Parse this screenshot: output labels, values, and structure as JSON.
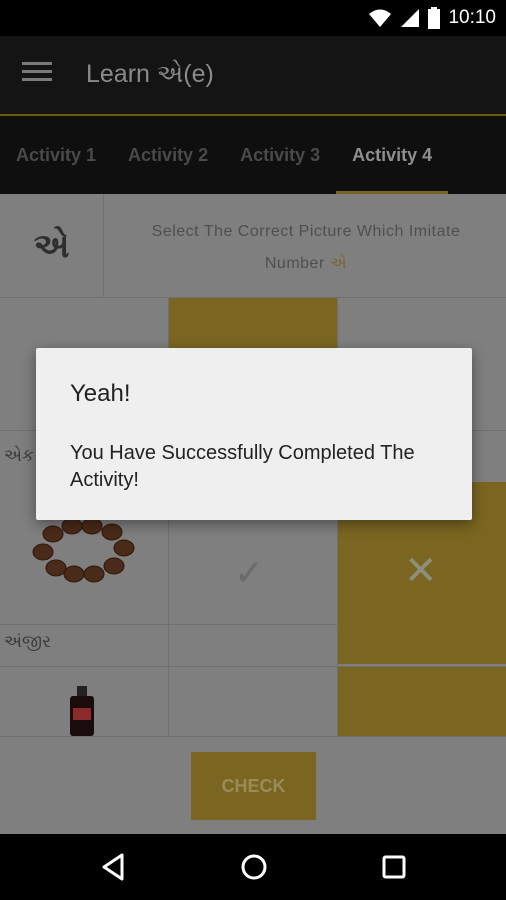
{
  "status_bar": {
    "time": "10:10",
    "icons": [
      "wifi-icon",
      "signal-icon",
      "battery-icon"
    ]
  },
  "app_bar": {
    "title": "Learn એ(e)",
    "menu_icon": "hamburger-menu-icon"
  },
  "tabs": [
    {
      "label": "Activity 1",
      "active": false
    },
    {
      "label": "Activity 2",
      "active": false
    },
    {
      "label": "Activity 3",
      "active": false
    },
    {
      "label": "Activity 4",
      "active": true
    }
  ],
  "activity": {
    "letter": "એ",
    "instruction_text": "Select The Correct Picture Which Imitate Number",
    "instruction_highlight": "એ",
    "rows": [
      {
        "label": "એક"
      },
      {
        "label": "અંજીર"
      }
    ],
    "check_label": "CHECK"
  },
  "dialog": {
    "title": "Yeah!",
    "message": "You Have Successfully Completed The Activity!"
  },
  "nav_bar": {
    "icons": [
      "back-icon",
      "home-icon",
      "recents-icon"
    ]
  },
  "colors": {
    "accent": "#F5C400",
    "dialog_background": "#EFEFEF",
    "app_bar": "#212121"
  }
}
